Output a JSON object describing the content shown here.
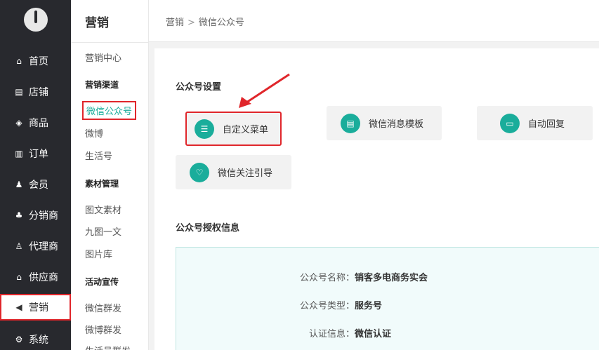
{
  "nav": {
    "items": [
      {
        "label": "首页",
        "icon": "home-icon",
        "glyph": "⌂"
      },
      {
        "label": "店铺",
        "icon": "store-icon",
        "glyph": "▤"
      },
      {
        "label": "商品",
        "icon": "goods-icon",
        "glyph": "◈"
      },
      {
        "label": "订单",
        "icon": "order-icon",
        "glyph": "▥"
      },
      {
        "label": "会员",
        "icon": "member-icon",
        "glyph": "♟"
      },
      {
        "label": "分销商",
        "icon": "distributor-icon",
        "glyph": "♣"
      },
      {
        "label": "代理商",
        "icon": "agent-icon",
        "glyph": "♙"
      },
      {
        "label": "供应商",
        "icon": "supplier-icon",
        "glyph": "⌂"
      },
      {
        "label": "营销",
        "icon": "megaphone-icon",
        "glyph": "◀",
        "active": true
      },
      {
        "label": "系统",
        "icon": "gear-icon",
        "glyph": "⚙"
      }
    ]
  },
  "sub": {
    "title": "营销",
    "marketing_center": "营销中心",
    "group_channels": "营销渠道",
    "wechat_mp": "微信公众号",
    "weibo": "微博",
    "life_account": "生活号",
    "group_materials": "素材管理",
    "rich_material": "图文素材",
    "nine_grid": "九图一文",
    "image_library": "图片库",
    "group_promo": "活动宣传",
    "wechat_mass": "微信群发",
    "weibo_mass": "微博群发",
    "life_mass": "生活号群发"
  },
  "breadcrumb": {
    "root": "营销",
    "sep": ">",
    "current": "微信公众号"
  },
  "settings": {
    "title": "公众号设置",
    "custom_menu": "自定义菜单",
    "msg_template": "微信消息模板",
    "auto_reply": "自动回复",
    "follow_guide": "微信关注引导"
  },
  "auth": {
    "title": "公众号授权信息",
    "name_label": "公众号名称：",
    "name_value": "销客多电商务实会",
    "type_label": "公众号类型：",
    "type_value": "服务号",
    "cert_label": "认证信息：",
    "cert_value": "微信认证"
  },
  "colors": {
    "accent": "#1aad9b",
    "highlight": "#e0262b",
    "nav_bg": "#28292e"
  }
}
